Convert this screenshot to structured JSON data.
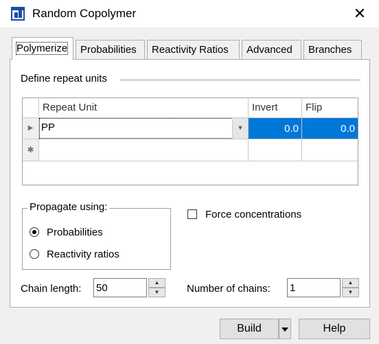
{
  "window": {
    "title": "Random Copolymer",
    "close_glyph": "✕"
  },
  "tabs": [
    {
      "label": "Polymerize",
      "active": true
    },
    {
      "label": "Probabilities",
      "active": false
    },
    {
      "label": "Reactivity Ratios",
      "active": false
    },
    {
      "label": "Advanced",
      "active": false
    },
    {
      "label": "Branches",
      "active": false
    }
  ],
  "repeat_units": {
    "section_label": "Define repeat units",
    "columns": [
      "Repeat Unit",
      "Invert",
      "Flip"
    ],
    "rows": [
      {
        "repeat_unit": "PP",
        "invert": "0.0",
        "flip": "0.0"
      }
    ],
    "row_indicator": "▶",
    "new_row_indicator": "✱"
  },
  "propagate": {
    "title": "Propagate using:",
    "options": [
      {
        "label": "Probabilities",
        "selected": true
      },
      {
        "label": "Reactivity ratios",
        "selected": false
      }
    ]
  },
  "force_concentrations": {
    "label": "Force concentrations",
    "checked": false
  },
  "chain_length": {
    "label": "Chain length:",
    "value": "50"
  },
  "number_of_chains": {
    "label": "Number of chains:",
    "value": "1"
  },
  "buttons": {
    "build": "Build",
    "help": "Help"
  },
  "icons": {
    "spin_up": "▲",
    "spin_down": "▼",
    "combo_drop": "▼"
  },
  "colors": {
    "selection": "#0078d7",
    "app_icon": "#1a4d9e"
  }
}
